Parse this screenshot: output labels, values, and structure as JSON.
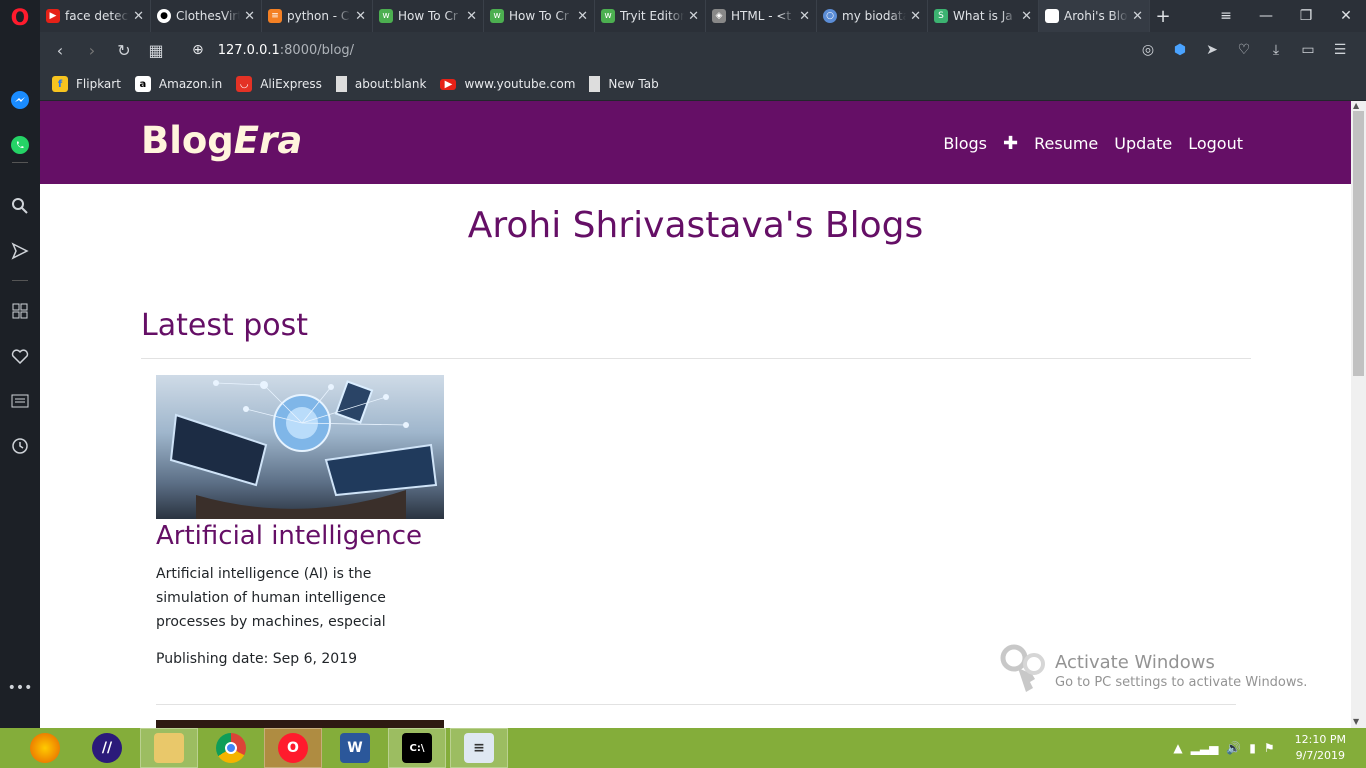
{
  "browser": {
    "tabs": [
      {
        "title": "face detecti",
        "icon": "youtube-icon",
        "color": "#e62117"
      },
      {
        "title": "ClothesVirt",
        "icon": "github-icon",
        "color": "#333333"
      },
      {
        "title": "python - C",
        "icon": "stackoverflow-icon",
        "color": "#f48024"
      },
      {
        "title": "How To Cr",
        "icon": "w3schools-icon",
        "color": "#4caf50"
      },
      {
        "title": "How To Cr",
        "icon": "w3schools-icon",
        "color": "#4caf50"
      },
      {
        "title": "Tryit Editor",
        "icon": "w3schools-icon",
        "color": "#4caf50"
      },
      {
        "title": "HTML - <t",
        "icon": "html-icon",
        "color": "#888888"
      },
      {
        "title": "my biodata",
        "icon": "circle-icon",
        "color": "#5b8dd6"
      },
      {
        "title": "What is Ja",
        "icon": "s-logo-icon",
        "color": "#3cb371"
      },
      {
        "title": "Arohi's Blo",
        "icon": "page-icon",
        "color": "#ffffff"
      }
    ],
    "url_host": "127.0.0.1",
    "url_path": ":8000/blog/",
    "bookmarks": [
      {
        "label": "Flipkart",
        "icon": "flipkart-icon",
        "color": "#f7c41f"
      },
      {
        "label": "Amazon.in",
        "icon": "amazon-icon",
        "color": "#ffffff"
      },
      {
        "label": "AliExpress",
        "icon": "aliexpress-icon",
        "color": "#e43225"
      },
      {
        "label": "about:blank",
        "icon": "page-icon",
        "color": "#dddddd"
      },
      {
        "label": "www.youtube.com",
        "icon": "youtube-icon",
        "color": "#e62117"
      },
      {
        "label": "New Tab",
        "icon": "page-icon",
        "color": "#dddddd"
      }
    ]
  },
  "site": {
    "brand_main": "Blog",
    "brand_italic": "Era",
    "nav": {
      "blogs": "Blogs",
      "plus": "✚",
      "resume": "Resume",
      "update": "Update",
      "logout": "Logout"
    },
    "heading": "Arohi Shrivastava's Blogs",
    "latest_label": "Latest post",
    "post": {
      "title": "Artificial intelligence",
      "excerpt": "Artificial intelligence (AI) is the simulation of human intelligence processes by machines, especial",
      "date": "Publishing date: Sep 6, 2019"
    }
  },
  "watermark": {
    "line1": "Activate Windows",
    "line2": "Go to PC settings to activate Windows."
  },
  "taskbar": {
    "time": "12:10 PM",
    "date": "9/7/2019"
  }
}
